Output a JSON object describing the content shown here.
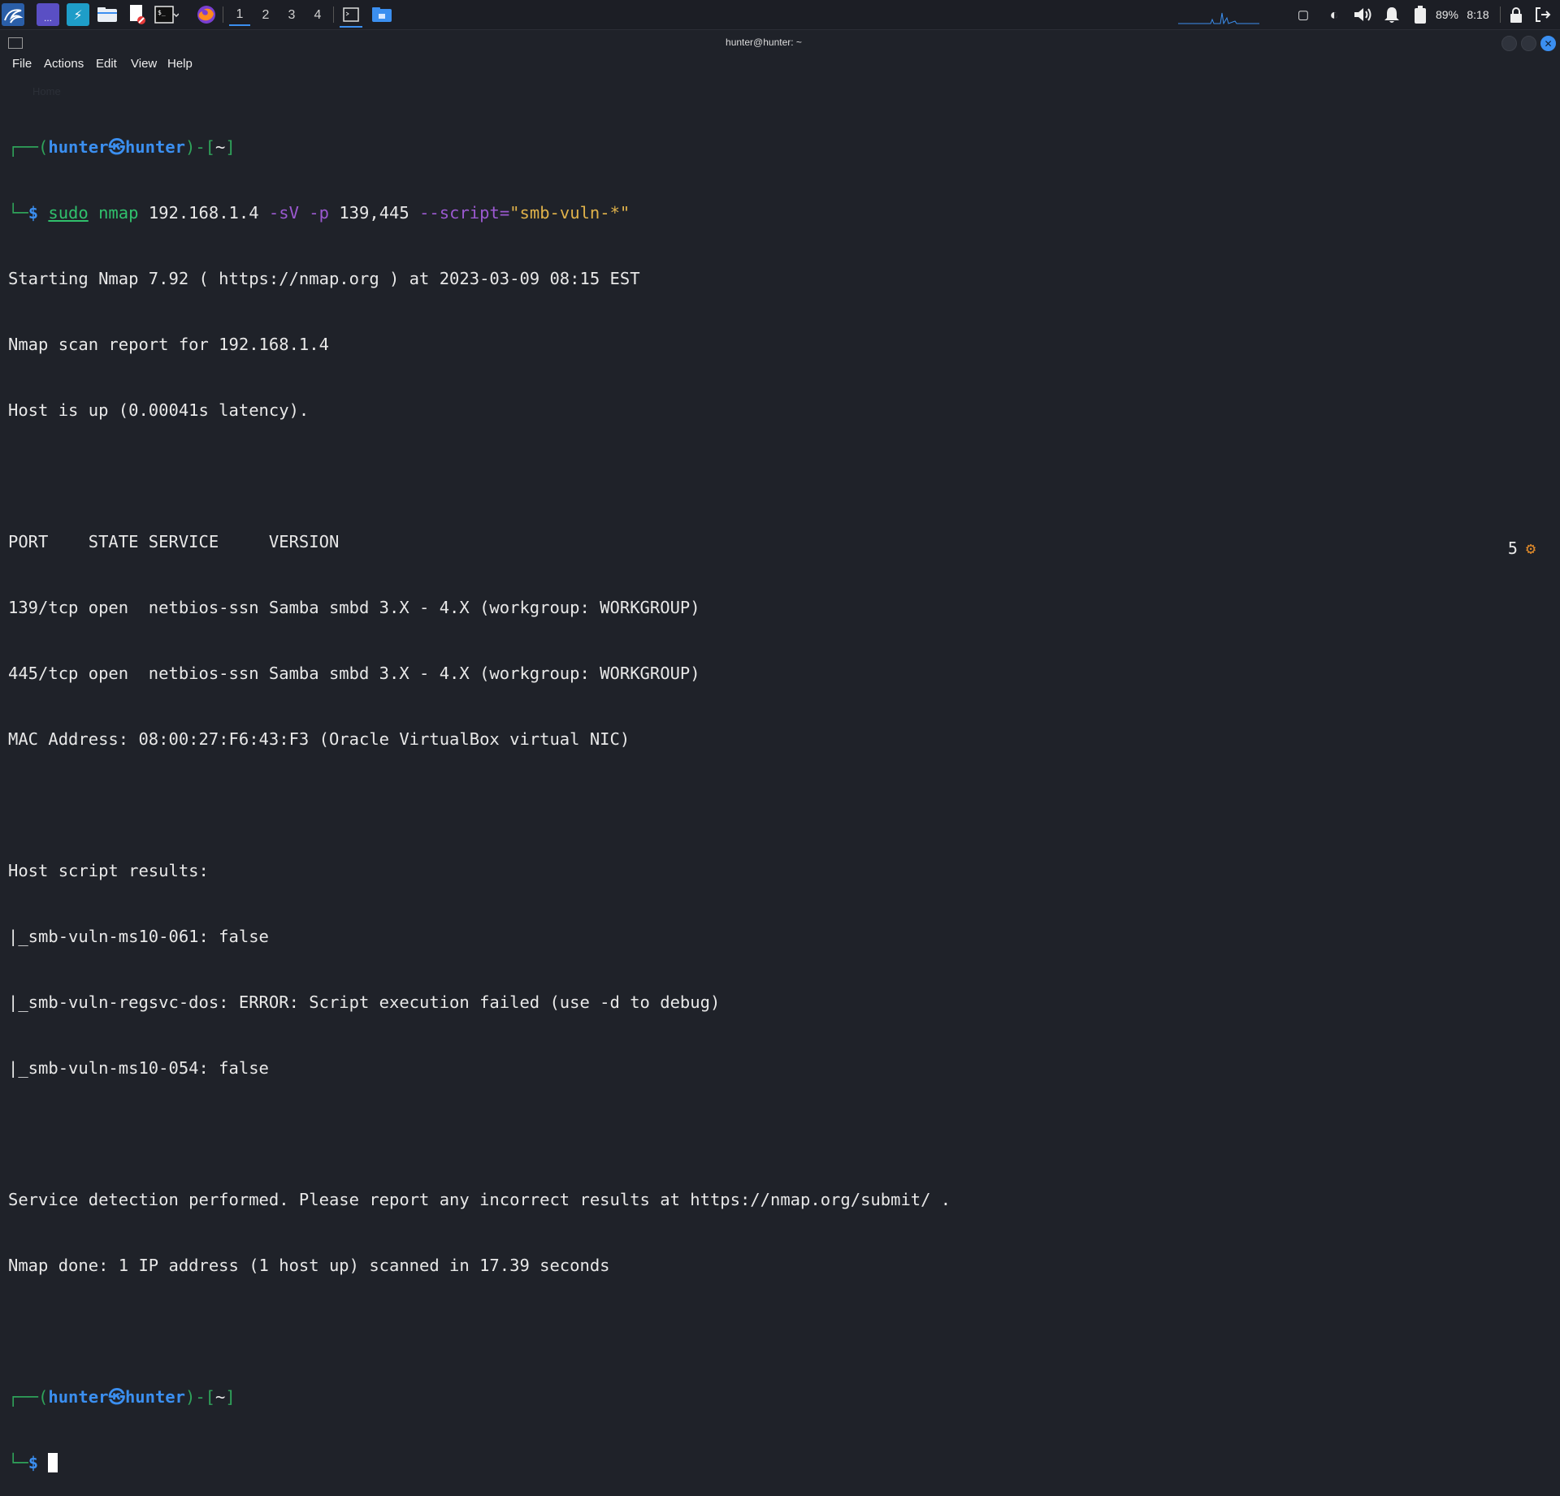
{
  "taskbar": {
    "workspaces": [
      "1",
      "2",
      "3",
      "4"
    ],
    "tray": {
      "battery": "89%",
      "clock": "8:18"
    }
  },
  "window": {
    "title": "hunter@hunter: ~",
    "menu": [
      "File",
      "Actions",
      "Edit",
      "View",
      "Help"
    ]
  },
  "terminal": {
    "prompt1": {
      "frame_open": "┌──(",
      "user": "hunter",
      "sep": "㉿",
      "host": "hunter",
      "frame_mid": ")-[",
      "dir": "~",
      "frame_close": "]"
    },
    "command": {
      "lead": "└─",
      "dollar": "$",
      "sudo": "sudo",
      "cmd": "nmap",
      "target": "192.168.1.4",
      "flag1": "-sV",
      "flag2": "-p",
      "ports": "139,445",
      "flag3": "--script=",
      "script": "\"smb-vuln-*\""
    },
    "output": [
      "Starting Nmap 7.92 ( https://nmap.org ) at 2023-03-09 08:15 EST",
      "Nmap scan report for 192.168.1.4",
      "Host is up (0.00041s latency).",
      "",
      "PORT    STATE SERVICE     VERSION",
      "139/tcp open  netbios-ssn Samba smbd 3.X - 4.X (workgroup: WORKGROUP)",
      "445/tcp open  netbios-ssn Samba smbd 3.X - 4.X (workgroup: WORKGROUP)",
      "MAC Address: 08:00:27:F6:43:F3 (Oracle VirtualBox virtual NIC)",
      "",
      "Host script results:",
      "|_smb-vuln-ms10-061: false",
      "|_smb-vuln-regsvc-dos: ERROR: Script execution failed (use -d to debug)",
      "|_smb-vuln-ms10-054: false",
      "",
      "Service detection performed. Please report any incorrect results at https://nmap.org/submit/ .",
      "Nmap done: 1 IP address (1 host up) scanned in 17.39 seconds",
      ""
    ],
    "prompt2": {
      "frame_open": "┌──(",
      "user": "hunter",
      "sep": "㉿",
      "host": "hunter",
      "frame_mid": ")-[",
      "dir": "~",
      "frame_close": "]"
    },
    "prompt2_line": {
      "lead": "└─",
      "dollar": "$"
    },
    "job_count": "5",
    "job_icon": "⚙"
  },
  "colors": {
    "accent": "#3b8ff0",
    "command_green": "#30c06c",
    "flag_purple": "#9b59d0",
    "string_yellow": "#e0b24a",
    "background": "#1f2229"
  }
}
